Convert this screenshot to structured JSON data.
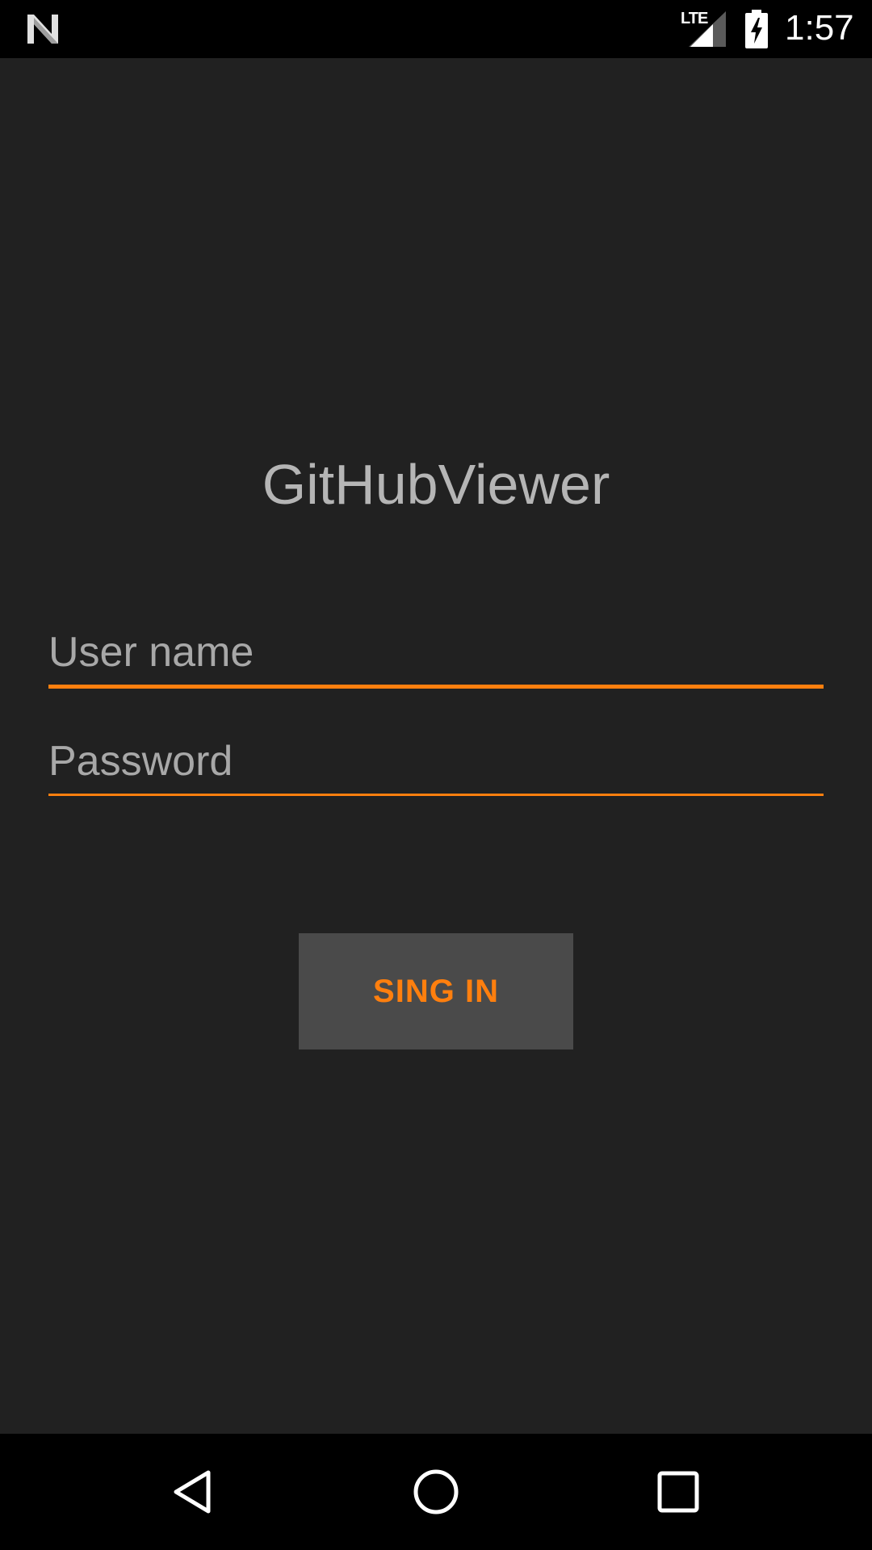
{
  "status_bar": {
    "network": "LTE",
    "time": "1:57",
    "icons": [
      "android-n-logo-icon",
      "signal-icon",
      "battery-charging-icon"
    ]
  },
  "app": {
    "title": "GitHubViewer"
  },
  "form": {
    "username_placeholder": "User name",
    "username_value": "",
    "password_placeholder": "Password",
    "password_value": "",
    "signin_label": "SING IN"
  },
  "nav_bar": {
    "buttons": [
      "back-icon",
      "home-icon",
      "recents-icon"
    ]
  },
  "colors": {
    "background": "#212121",
    "accent": "#ff7f0e",
    "button_bg": "#4a4a4a",
    "title_text": "#b5b5b5",
    "bars": "#000000"
  }
}
